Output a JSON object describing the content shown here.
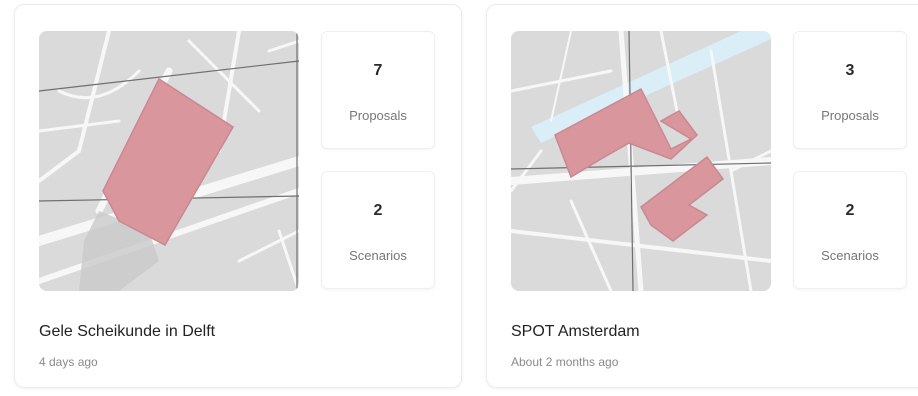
{
  "projects": [
    {
      "name": "Gele Scheikunde in Delft",
      "updated": "4 days ago",
      "proposals_count": "7",
      "proposals_label": "Proposals",
      "scenarios_count": "2",
      "scenarios_label": "Scenarios"
    },
    {
      "name": "SPOT Amsterdam",
      "updated": "About 2 months ago",
      "proposals_count": "3",
      "proposals_label": "Proposals",
      "scenarios_count": "2",
      "scenarios_label": "Scenarios"
    }
  ],
  "colors": {
    "map_background": "#dadada",
    "road": "#f7f7f7",
    "building_highlight": "#d9969c",
    "water": "#d9eef6",
    "transit_line": "#6f6f6f"
  }
}
